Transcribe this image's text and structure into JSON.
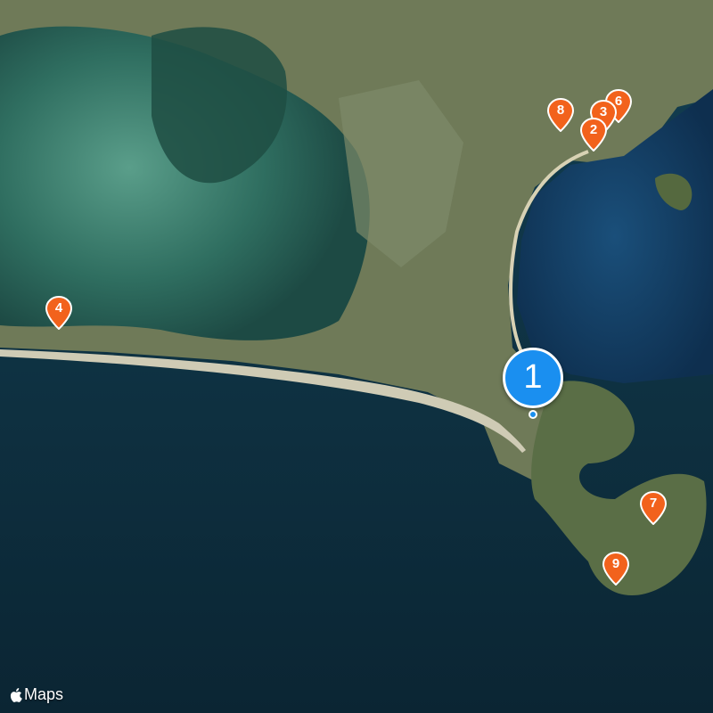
{
  "map": {
    "attribution_label": "Maps",
    "icons": {
      "attribution": "apple-logo-icon"
    },
    "colors": {
      "pin_orange": "#f2621c",
      "pin_blue": "#1a8ff0",
      "ocean": "#0c2a3a"
    },
    "selected_pin": {
      "label": "1"
    },
    "pins": [
      {
        "id": "8",
        "label": "8"
      },
      {
        "id": "6",
        "label": "6"
      },
      {
        "id": "3",
        "label": "3"
      },
      {
        "id": "2",
        "label": "2"
      },
      {
        "id": "4",
        "label": "4"
      },
      {
        "id": "7",
        "label": "7"
      },
      {
        "id": "9",
        "label": "9"
      }
    ]
  }
}
